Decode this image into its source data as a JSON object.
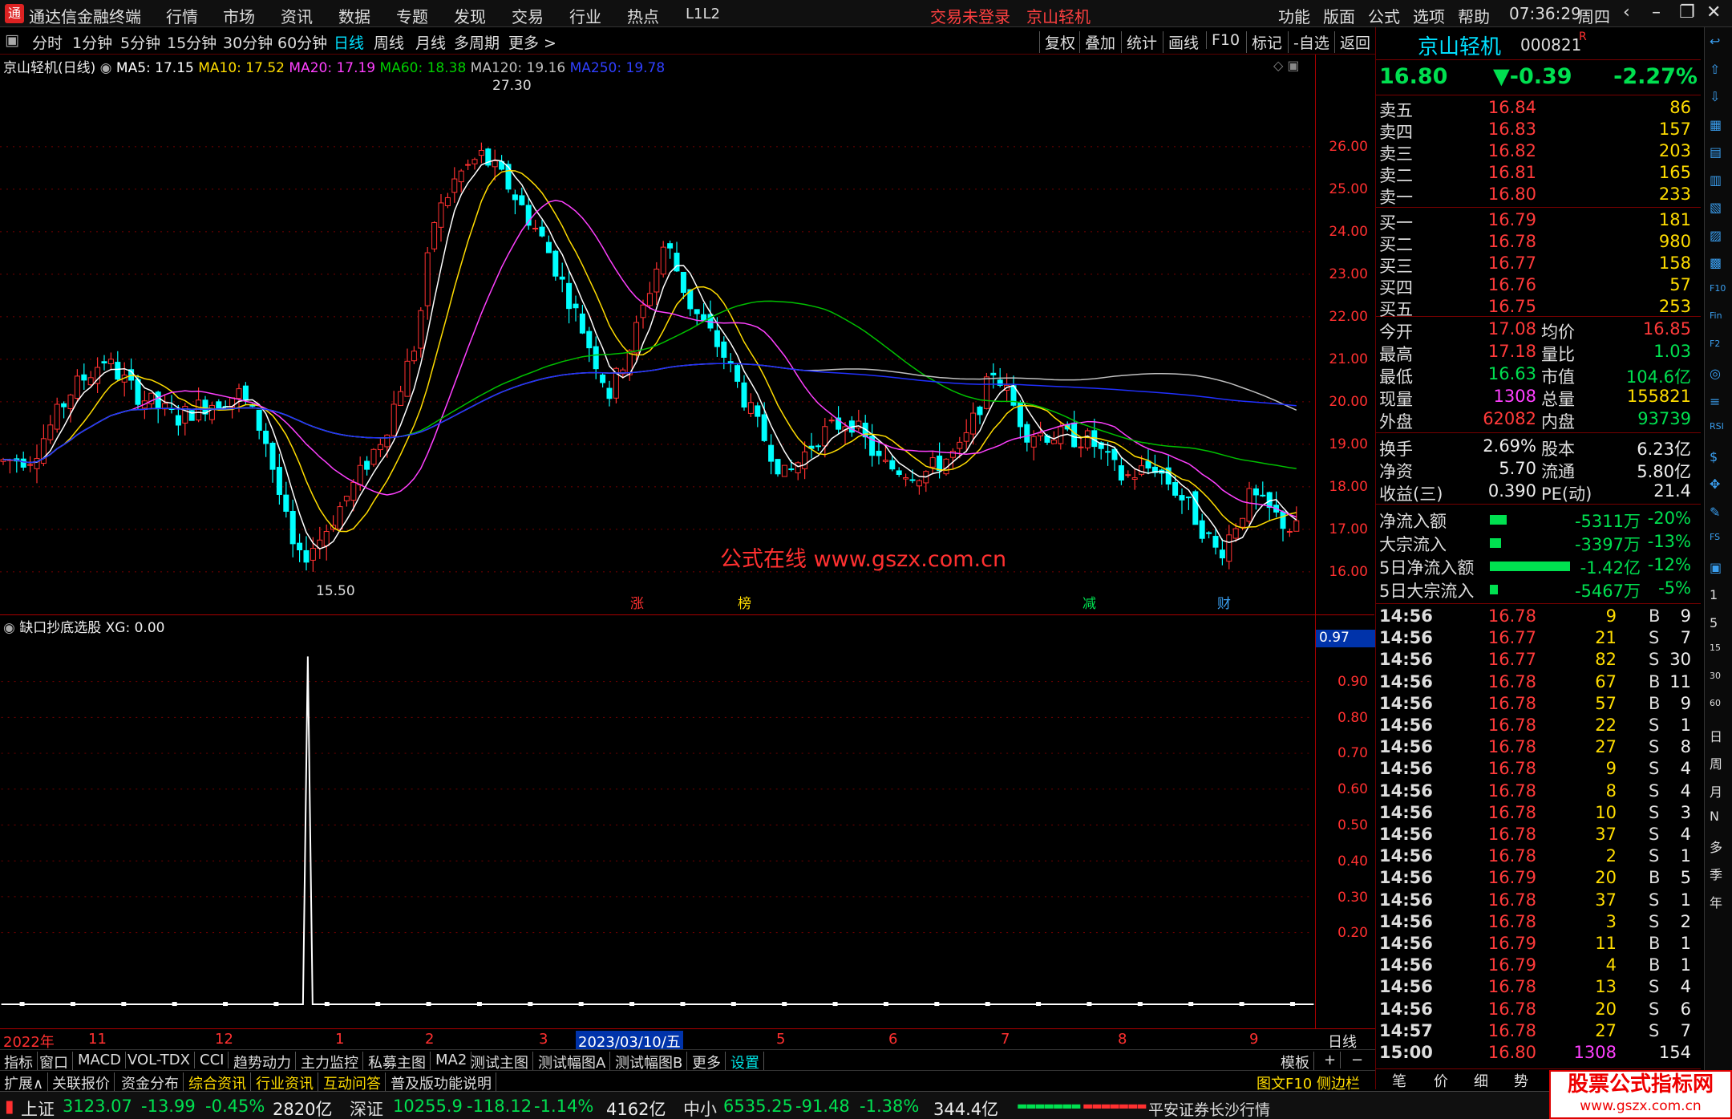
{
  "app": {
    "title": "通达信金融终端",
    "logo": "通"
  },
  "menu": [
    "行情",
    "市场",
    "资讯",
    "数据",
    "专题",
    "发现",
    "交易",
    "行业",
    "热点",
    "L1L2"
  ],
  "warning": "交易未登录",
  "stock_title_top": "京山轻机",
  "menu_right": [
    "功能",
    "版面",
    "公式",
    "选项",
    "帮助"
  ],
  "clock": "07:36:29",
  "weekday": "周四",
  "periods": [
    "分时",
    "1分钟",
    "5分钟",
    "15分钟",
    "30分钟",
    "60分钟",
    "日线",
    "周线",
    "月线",
    "多周期",
    "更多 >"
  ],
  "active_period": "日线",
  "toolbar_right": [
    "复权",
    "叠加",
    "统计",
    "画线",
    "F10",
    "标记",
    "-自选",
    "返回"
  ],
  "ma_legend": {
    "name": "京山轻机(日线)",
    "ma5": "MA5: 17.15",
    "ma10": "MA10: 17.52",
    "ma20": "MA20: 17.19",
    "ma60": "MA60: 18.38",
    "ma120": "MA120: 19.16",
    "ma250": "MA250: 19.78"
  },
  "colors": {
    "ma5": "#ffffff",
    "ma10": "#ffdc00",
    "ma20": "#ff40ff",
    "ma60": "#00c000",
    "ma120": "#c0c0c0",
    "ma250": "#2030ff",
    "up": "#ff3030",
    "down": "#00ffff"
  },
  "price_axis": [
    "26.00",
    "25.00",
    "24.00",
    "23.00",
    "22.00",
    "21.00",
    "20.00",
    "19.00",
    "18.00",
    "17.00",
    "16.00"
  ],
  "high_label": "27.30",
  "low_label": "15.50",
  "markers": [
    "涨",
    "榜",
    "减",
    "财"
  ],
  "watermark": "公式在线  www.gszx.com.cn",
  "indicator": {
    "name": "缺口抄底选股",
    "value": "XG: 0.00",
    "current": "0.97",
    "axis": [
      "0.90",
      "0.80",
      "0.70",
      "0.60",
      "0.50",
      "0.40",
      "0.30",
      "0.20"
    ]
  },
  "date_axis": [
    "2022年",
    "11",
    "12",
    "1",
    "2",
    "3",
    "2023/03/10/五",
    "5",
    "6",
    "7",
    "8",
    "9"
  ],
  "date_mode": "日线",
  "tabs1": [
    "指标",
    "窗口",
    "MACD",
    "VOL-TDX",
    "CCI",
    "趋势动力",
    "主力监控",
    "私募主图",
    "MA2",
    "测试主图",
    "测试幅图A",
    "测试幅图B",
    "更多",
    "设置"
  ],
  "tabs1_right": [
    "模板",
    "+",
    "−"
  ],
  "tabs2": [
    "扩展∧",
    "关联报价",
    "资金分布",
    "综合资讯",
    "行业资讯",
    "互动问答",
    "普及版功能说明"
  ],
  "tabs2_right": "图文F10  侧边栏《",
  "panel_tabs": [
    "笔",
    "价",
    "细",
    "势"
  ],
  "quote": {
    "name": "京山轻机",
    "code": "000821",
    "flag": "R",
    "price": "16.80",
    "change": "▼-0.39",
    "pct": "-2.27%",
    "asks": [
      [
        "卖五",
        "16.84",
        "86"
      ],
      [
        "卖四",
        "16.83",
        "157"
      ],
      [
        "卖三",
        "16.82",
        "203"
      ],
      [
        "卖二",
        "16.81",
        "165"
      ],
      [
        "卖一",
        "16.80",
        "233"
      ]
    ],
    "bids": [
      [
        "买一",
        "16.79",
        "181"
      ],
      [
        "买二",
        "16.78",
        "980"
      ],
      [
        "买三",
        "16.77",
        "158"
      ],
      [
        "买四",
        "16.76",
        "57"
      ],
      [
        "买五",
        "16.75",
        "253"
      ]
    ],
    "stats": [
      [
        "今开",
        "17.08",
        "均价",
        "16.85"
      ],
      [
        "最高",
        "17.18",
        "量比",
        "1.03"
      ],
      [
        "最低",
        "16.63",
        "市值",
        "104.6亿"
      ],
      [
        "现量",
        "1308",
        "总量",
        "155821"
      ],
      [
        "外盘",
        "62082",
        "内盘",
        "93739"
      ]
    ],
    "stats2": [
      [
        "换手",
        "2.69%",
        "股本",
        "6.23亿"
      ],
      [
        "净资",
        "5.70",
        "流通",
        "5.80亿"
      ],
      [
        "收益(三)",
        "0.390",
        "PE(动)",
        "21.4"
      ]
    ],
    "flows": [
      [
        "净流入额",
        "-5311万",
        "-20%",
        0.2
      ],
      [
        "大宗流入",
        "-3397万",
        "-13%",
        0.13
      ],
      [
        "5日净流入额",
        "-1.42亿",
        "-12%",
        0.95
      ],
      [
        "5日大宗流入",
        "-5467万",
        "-5%",
        0.05
      ]
    ],
    "ticks": [
      [
        "14:56",
        "16.78",
        "9",
        "B",
        "9"
      ],
      [
        "14:56",
        "16.77",
        "21",
        "S",
        "7"
      ],
      [
        "14:56",
        "16.77",
        "82",
        "S",
        "30"
      ],
      [
        "14:56",
        "16.78",
        "67",
        "B",
        "11"
      ],
      [
        "14:56",
        "16.78",
        "57",
        "B",
        "9"
      ],
      [
        "14:56",
        "16.78",
        "22",
        "S",
        "1"
      ],
      [
        "14:56",
        "16.78",
        "27",
        "S",
        "8"
      ],
      [
        "14:56",
        "16.78",
        "9",
        "S",
        "4"
      ],
      [
        "14:56",
        "16.78",
        "8",
        "S",
        "4"
      ],
      [
        "14:56",
        "16.78",
        "10",
        "S",
        "3"
      ],
      [
        "14:56",
        "16.78",
        "37",
        "S",
        "4"
      ],
      [
        "14:56",
        "16.78",
        "2",
        "S",
        "1"
      ],
      [
        "14:56",
        "16.79",
        "20",
        "B",
        "5"
      ],
      [
        "14:56",
        "16.78",
        "37",
        "S",
        "1"
      ],
      [
        "14:56",
        "16.78",
        "3",
        "S",
        "2"
      ],
      [
        "14:56",
        "16.79",
        "11",
        "B",
        "1"
      ],
      [
        "14:56",
        "16.79",
        "4",
        "B",
        "1"
      ],
      [
        "14:56",
        "16.78",
        "13",
        "S",
        "4"
      ],
      [
        "14:56",
        "16.78",
        "20",
        "S",
        "6"
      ],
      [
        "14:57",
        "16.78",
        "27",
        "S",
        "7"
      ],
      [
        "15:00",
        "16.80",
        "1308",
        "",
        "154"
      ]
    ]
  },
  "sidebar_icons": [
    "↩",
    "⇧",
    "⇩",
    "▦",
    "▤",
    "▥",
    "▧",
    "▨",
    "▩",
    "F10",
    "Fin",
    "F2",
    "◎",
    "≡",
    "RSI",
    "$",
    "✥",
    "✎",
    "FS",
    "▣",
    "1",
    "5",
    "15",
    "30",
    "60",
    "日",
    "周",
    "月",
    "N",
    "多",
    "季",
    "年"
  ],
  "status": {
    "sh": [
      "上证",
      "3123.07",
      "-13.99",
      "-0.45%",
      "2820亿"
    ],
    "sz": [
      "深证",
      "10255.9",
      "-118.12",
      "-1.14%",
      "4162亿"
    ],
    "zx": [
      "中小",
      "6535.25",
      "-91.48",
      "-1.38%",
      "344.4亿"
    ],
    "broker": "平安证券长沙行情"
  },
  "corner_logo": {
    "cn": "股票公式指标网",
    "url": "www.gszx.com.cn"
  }
}
